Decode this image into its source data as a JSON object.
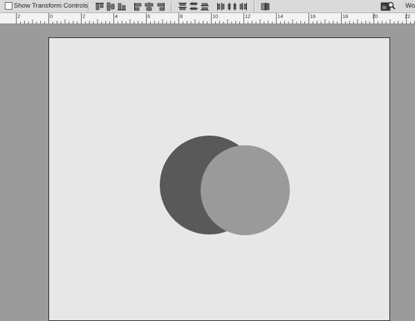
{
  "options_bar": {
    "show_transform_controls": {
      "label": "Show Transform Controls",
      "checked": false
    },
    "align_icons": [
      "align-top-edges-icon",
      "align-vertical-centers-icon",
      "align-bottom-edges-icon",
      "align-left-edges-icon",
      "align-horizontal-centers-icon",
      "align-right-edges-icon"
    ],
    "distribute_icons": [
      "distribute-top-icon",
      "distribute-vertical-centers-icon",
      "distribute-bottom-icon",
      "distribute-left-icon",
      "distribute-horizontal-centers-icon",
      "distribute-right-icon"
    ],
    "auto_align_icon": "auto-align-layers-icon",
    "workspace_label": "Wo"
  },
  "ruler": {
    "labels": [
      "2",
      "0",
      "2",
      "4",
      "6",
      "8",
      "10",
      "12",
      "14",
      "16",
      "18",
      "20",
      "22"
    ]
  },
  "document": {
    "background": "#e7e7e7",
    "shapes": [
      {
        "name": "dark-circle",
        "color": "#595959"
      },
      {
        "name": "light-circle",
        "color": "#9a9a9a"
      }
    ]
  }
}
